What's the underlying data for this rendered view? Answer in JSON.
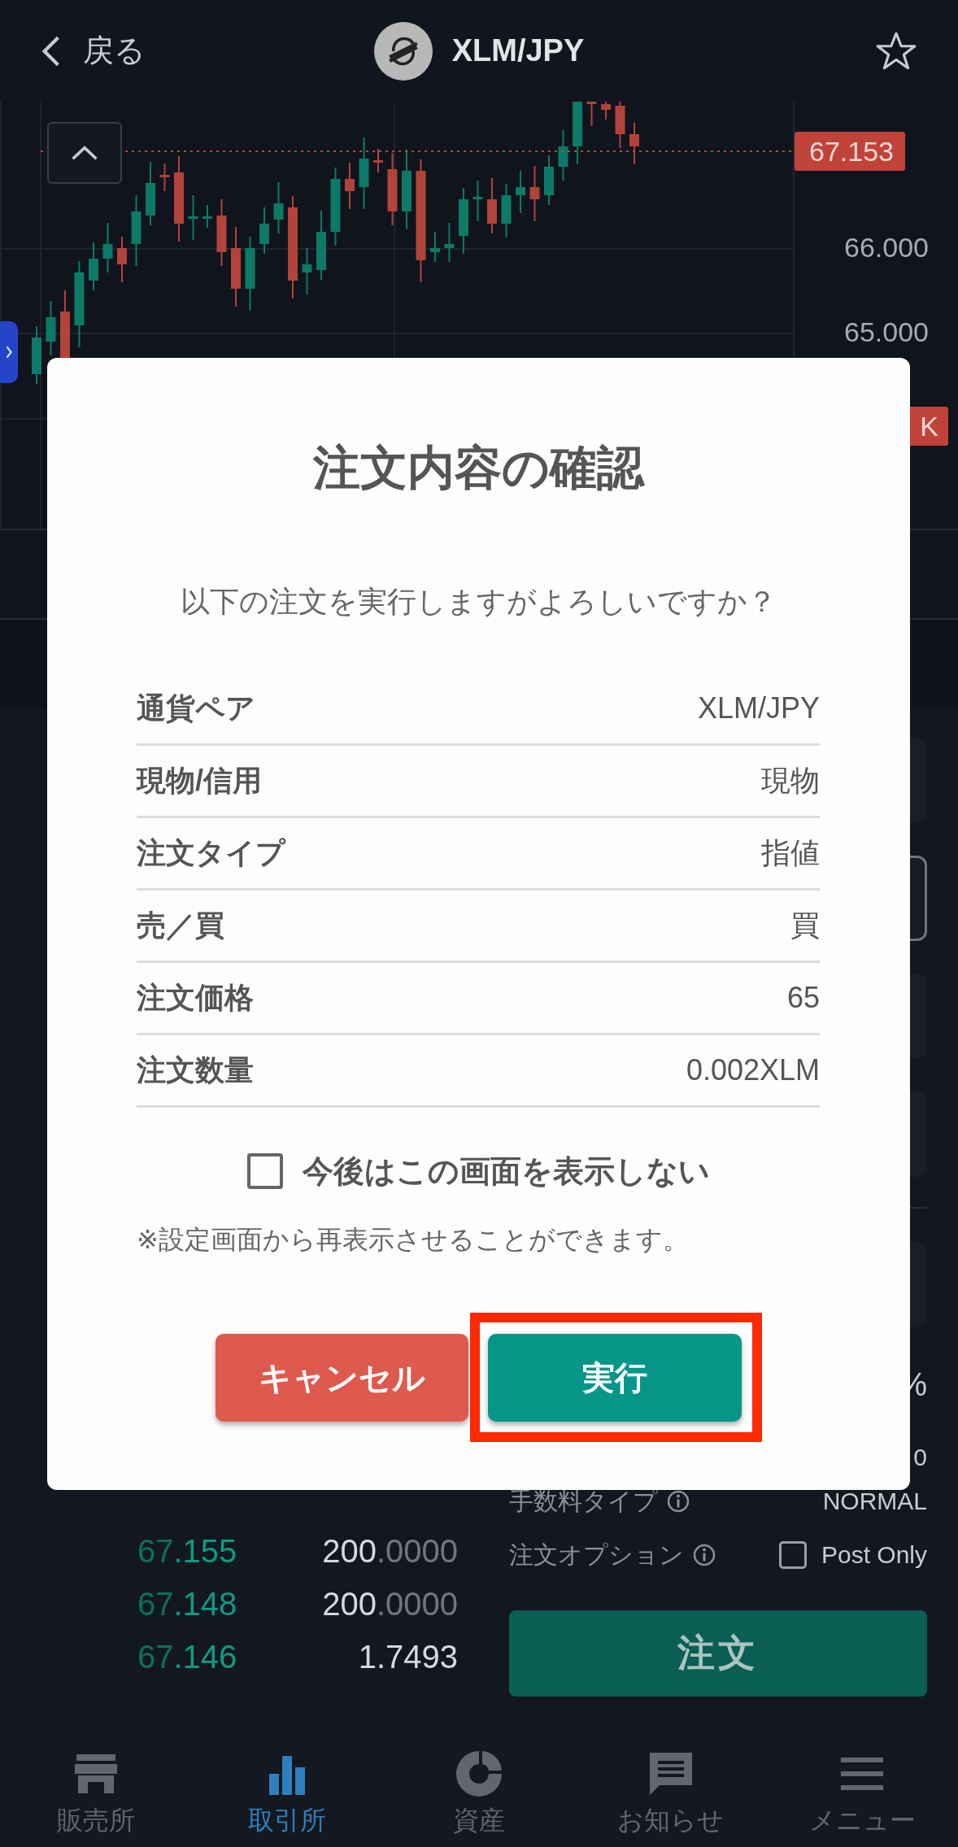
{
  "header": {
    "back_label": "戻る",
    "pair": "XLM/JPY",
    "favorite": false
  },
  "chart": {
    "current_price": "67.153",
    "price_labels": [
      "66.000",
      "65.000"
    ],
    "volume_tag": "K"
  },
  "order_book": [
    {
      "price_main": "67",
      "price_tail": ".155",
      "amount": "200",
      "amount_dim": ".0000"
    },
    {
      "price_main": "67",
      "price_tail": ".148",
      "amount": "200",
      "amount_dim": ".0000"
    },
    {
      "price_main": "67",
      "price_tail": ".146",
      "amount": "1.7493"
    }
  ],
  "order_panel": {
    "input_fields": [
      {
        "selected": false
      },
      {
        "selected": true
      },
      {
        "selected": false
      },
      {
        "selected": false
      },
      {
        "selected": false
      }
    ],
    "percent_text": "%",
    "fee_partial": "0",
    "fee_type_label": "手数料タイプ",
    "fee_type": "NORMAL",
    "option_label": "注文オプション",
    "post_only": {
      "label": "Post Only",
      "checked": false
    },
    "order_button": "注文"
  },
  "dialog": {
    "title": "注文内容の確認",
    "message": "以下の注文を実行しますがよろしいですか？",
    "rows": [
      {
        "label": "通貨ペア",
        "value": "XLM/JPY"
      },
      {
        "label": "現物/信用",
        "value": "現物"
      },
      {
        "label": "注文タイプ",
        "value": "指値"
      },
      {
        "label": "売／買",
        "value": "買"
      },
      {
        "label": "注文価格",
        "value": "65"
      },
      {
        "label": "注文数量",
        "value": "0.002XLM"
      }
    ],
    "dont_show_again": {
      "label": "今後はこの画面を表示しない",
      "checked": false
    },
    "note": "※設定画面から再表示させることができます。",
    "cancel_button": "キャンセル",
    "execute_button": "実行",
    "execute_highlighted": true
  },
  "bottom_nav": [
    {
      "kind": "store",
      "label": "販売所",
      "selected": false
    },
    {
      "kind": "bars",
      "label": "取引所",
      "selected": true
    },
    {
      "kind": "pie",
      "label": "資産",
      "selected": false
    },
    {
      "kind": "chat",
      "label": "お知らせ",
      "selected": false
    },
    {
      "kind": "menu",
      "label": "メニュー",
      "selected": false
    }
  ]
}
